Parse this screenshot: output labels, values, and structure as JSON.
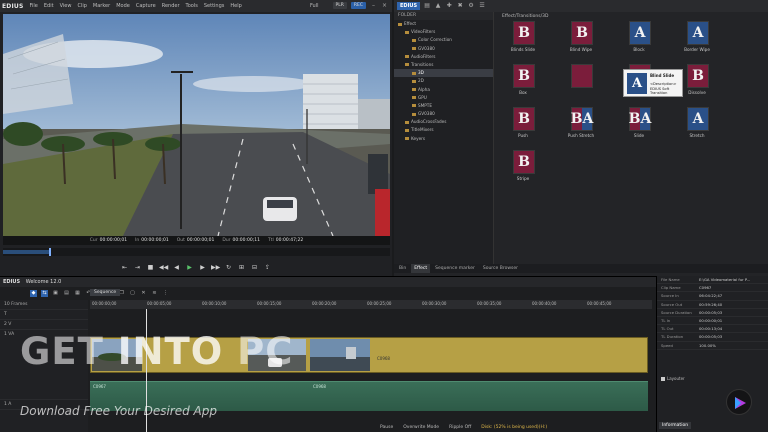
{
  "player": {
    "brand": "EDIUS",
    "menu": [
      "File",
      "Edit",
      "View",
      "Clip",
      "Marker",
      "Mode",
      "Capture",
      "Render",
      "Tools",
      "Settings",
      "Help"
    ],
    "mode": "Full",
    "badge_plr": "PLR",
    "badge_rec": "REC",
    "timecodes": [
      {
        "label": "Cur",
        "value": "00:00:00;01"
      },
      {
        "label": "In",
        "value": "00:00:00;01"
      },
      {
        "label": "Out",
        "value": "00:00:00;01"
      },
      {
        "label": "Dur",
        "value": "00:00:00;11"
      },
      {
        "label": "Ttl",
        "value": "00:00:47;22"
      }
    ],
    "progress": 0.12
  },
  "effects": {
    "title": "EDIUS",
    "folder_header": "FOLDER",
    "tree": [
      "Effect",
      "VideoFilters",
      "Color Correction",
      "GV0380",
      "AudioFilters",
      "Transitions",
      "3D",
      "2D",
      "Alpha",
      "GPU",
      "SMPTE",
      "GV0380",
      "AudioCrossFades",
      "TitleMixers",
      "Keyers"
    ],
    "selected_tree_index": 6,
    "path": "Effect/Transitions/3D",
    "thumbs": [
      {
        "label": "Blinds Slide",
        "glyph": "B",
        "style": "red"
      },
      {
        "label": "Blind Wipe",
        "glyph": "B",
        "style": "red"
      },
      {
        "label": "Block",
        "glyph": "A",
        "style": "blue"
      },
      {
        "label": "Border Wipe",
        "glyph": "A",
        "style": "blue"
      },
      {
        "label": "Box",
        "glyph": "B",
        "style": "red"
      },
      {
        "label": "",
        "glyph": "",
        "style": "red"
      },
      {
        "label": "Clock",
        "glyph": "B",
        "style": "red"
      },
      {
        "label": "Dissolve",
        "glyph": "B",
        "style": "red"
      },
      {
        "label": "Push",
        "glyph": "B",
        "style": "red"
      },
      {
        "label": "Push Stretch",
        "glyph": "BA",
        "style": "split"
      },
      {
        "label": "Slide",
        "glyph": "BA",
        "style": "split"
      },
      {
        "label": "Stretch",
        "glyph": "A",
        "style": "blue"
      },
      {
        "label": "Stripe",
        "glyph": "B",
        "style": "red"
      }
    ],
    "tooltip": {
      "title": "Blind Slide",
      "desc_line1": "<Description>",
      "desc_line2": "EDIUS Soft Transition",
      "glyph": "A"
    },
    "tabs": [
      "Bin",
      "Effect",
      "Sequence marker",
      "Source Browser"
    ],
    "active_tab": "Effect"
  },
  "timeline": {
    "brand": "EDIUS",
    "project": "Welcome 12.0",
    "sequence_tab": "Sequence",
    "ruler": [
      "00:00:00;00",
      "00:00:05;00",
      "00:00:10;00",
      "00:00:15;00",
      "00:00:20;00",
      "00:00:25;00",
      "00:00:30;00",
      "00:00:35;00",
      "00:00:40;00",
      "00:00:45;00"
    ],
    "tracks": [
      "T",
      "2 V",
      "1 VA",
      "1 A"
    ],
    "frames_label": "10 Frames",
    "clip_label": "C0968",
    "audio_label1": "C0967",
    "audio_label2": "C0968",
    "status": {
      "pause": "Pause",
      "overwrite": "Overwrite Mode",
      "ripple": "Ripple Off",
      "disk": "Disk: (52% is being used)(H:)"
    }
  },
  "info": {
    "rows": [
      {
        "k": "File Name",
        "v": "E:\\GA Videomaterial fur P..."
      },
      {
        "k": "Clip Name",
        "v": "C0967"
      },
      {
        "k": "Source In",
        "v": "06:04:22;47"
      },
      {
        "k": "Source Out",
        "v": "00:59:26;40"
      },
      {
        "k": "Source Duration",
        "v": "00:00:05;03"
      },
      {
        "k": "TL In",
        "v": "00:00:00;01"
      },
      {
        "k": "TL Out",
        "v": "00:00:13;04"
      },
      {
        "k": "TL Duration",
        "v": "00:00:05;03"
      },
      {
        "k": "Speed",
        "v": "100.00%"
      }
    ],
    "layouter": "Layouter",
    "tab": "Information"
  },
  "watermark": {
    "get": "GET",
    "into": "INTO",
    "pc": "PC",
    "sub": "Download Free Your Desired App"
  }
}
